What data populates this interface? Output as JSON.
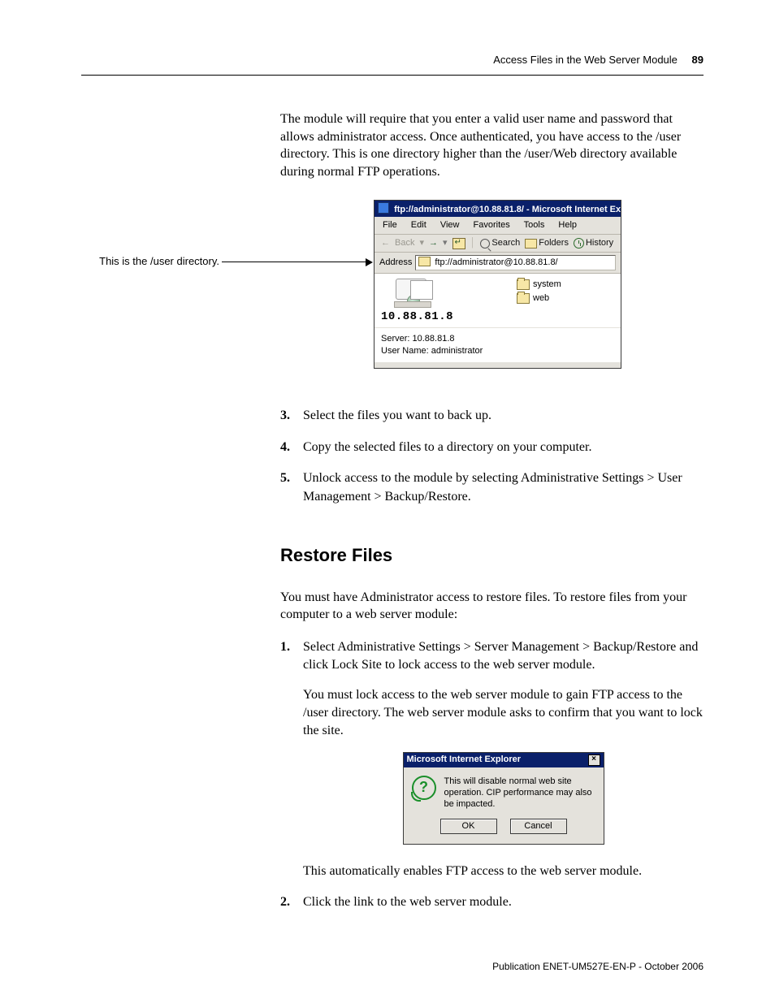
{
  "header": {
    "chapter": "Access Files in the Web Server Module",
    "page_number": "89"
  },
  "intro_paragraph": "The module will require that you enter a valid user name and password that allows administrator access. Once authenticated, you have access to the /user directory. This is one directory higher than the /user/Web directory available during normal FTP operations.",
  "callout_text": "This is the /user directory.",
  "ie": {
    "title": "ftp://administrator@10.88.81.8/ - Microsoft Internet Ex",
    "menu": {
      "file": "File",
      "edit": "Edit",
      "view": "View",
      "favorites": "Favorites",
      "tools": "Tools",
      "help": "Help"
    },
    "toolbar": {
      "back": "Back",
      "search": "Search",
      "folders": "Folders",
      "history": "History"
    },
    "address_label": "Address",
    "address_value": "ftp://administrator@10.88.81.8/",
    "server_ip": "10.88.81.8",
    "folders": {
      "system": "system",
      "web": "web"
    },
    "status": {
      "server": "Server: 10.88.81.8",
      "user": "User Name: administrator"
    }
  },
  "steps_a": {
    "s3": "Select the files you want to back up.",
    "s4": "Copy the selected files to a directory on your computer.",
    "s5": "Unlock access to the module by selecting Administrative Settings > User Management > Backup/Restore."
  },
  "section_heading": "Restore Files",
  "restore_intro": "You must have Administrator access to restore files. To restore files from your computer to a web server module:",
  "steps_b": {
    "s1": "Select Administrative Settings > Server Management > Backup/Restore and click Lock Site to lock access to the web server module.",
    "s1b": "You must lock access to the web server module to gain FTP access to the /user directory. The web server module asks to confirm that you want to lock the site.",
    "s1c": "This automatically enables FTP access to the web server module.",
    "s2": "Click the link to the web server module."
  },
  "dialog": {
    "title": "Microsoft Internet Explorer",
    "message": "This will disable normal web site operation. CIP performance may also be impacted.",
    "ok": "OK",
    "cancel": "Cancel"
  },
  "footer": "Publication ENET-UM527E-EN-P - October 2006"
}
